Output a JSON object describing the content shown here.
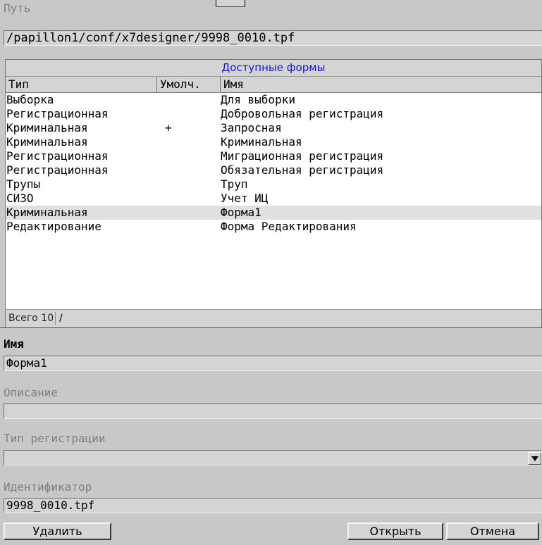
{
  "path": {
    "label": "Путь",
    "value": "/papillon1/conf/x7designer/9998_0010.tpf"
  },
  "forms": {
    "title": "Доступные формы",
    "columns": [
      "Тип",
      "Умолч.",
      "Имя"
    ],
    "rows": [
      {
        "type": "Выборка",
        "default": "",
        "name": "Для выборки"
      },
      {
        "type": "Регистрационная",
        "default": "",
        "name": "Добровольная регистрация"
      },
      {
        "type": "Криминальная",
        "default": "+",
        "name": "Запросная"
      },
      {
        "type": "Криминальная",
        "default": "",
        "name": "Криминальная"
      },
      {
        "type": "Регистрационная",
        "default": "",
        "name": "Миграционная регистрация"
      },
      {
        "type": "Регистрационная",
        "default": "",
        "name": "Обязательная регистрация"
      },
      {
        "type": "Трупы",
        "default": "",
        "name": "Труп"
      },
      {
        "type": "СИЗО",
        "default": "",
        "name": "Учет ИЦ"
      },
      {
        "type": "Криминальная",
        "default": "",
        "name": "Форма1",
        "selected": true
      },
      {
        "type": "Редактирование",
        "default": "",
        "name": "Форма Редактирования"
      }
    ],
    "status": {
      "count": "Всего 10",
      "extra": "/"
    }
  },
  "name": {
    "label": "Имя",
    "value": "Форма1"
  },
  "description": {
    "label": "Описание",
    "value": ""
  },
  "reg_type": {
    "label": "Тип регистрации",
    "value": ""
  },
  "identifier": {
    "label": "Идентификатор",
    "value": "9998_0010.tpf"
  },
  "buttons": {
    "delete": "Удалить",
    "open": "Открыть",
    "cancel": "Отмена"
  }
}
